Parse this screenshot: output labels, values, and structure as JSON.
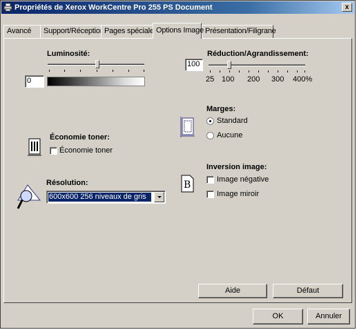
{
  "window": {
    "title": "Propriétés de Xerox WorkCentre Pro 255 PS Document",
    "close": "x"
  },
  "tabs": [
    {
      "label": "Avancé"
    },
    {
      "label": "Support/Réception"
    },
    {
      "label": "Pages spéciales"
    },
    {
      "label": "Options Image",
      "active": true
    },
    {
      "label": "Présentation/Filigrane"
    }
  ],
  "luminosite": {
    "label": "Luminosité:",
    "value": "0"
  },
  "reduction": {
    "label": "Réduction/Agrandissement:",
    "value": "100",
    "scale": [
      "25",
      "100",
      "200",
      "300",
      "400%"
    ]
  },
  "marges": {
    "label": "Marges:",
    "options": [
      "Standard",
      "Aucune"
    ],
    "selected": "Standard"
  },
  "economie": {
    "label": "Économie toner:",
    "checkbox": "Économie toner",
    "checked": false
  },
  "inversion": {
    "label": "Inversion image:",
    "options": [
      "Image négative",
      "Image miroir"
    ]
  },
  "resolution": {
    "label": "Résolution:",
    "value": "600x600 256 niveaux de gris"
  },
  "buttons": {
    "aide": "Aide",
    "defaut": "Défaut",
    "ok": "OK",
    "annuler": "Annuler"
  },
  "colors": {
    "titlebar": "#0a246a",
    "face": "#d4d0c8",
    "selection": "#0a246a"
  },
  "icons": [
    "printer-icon",
    "toner-icon",
    "margins-icon",
    "magnifier-icon",
    "inversion-icon"
  ]
}
